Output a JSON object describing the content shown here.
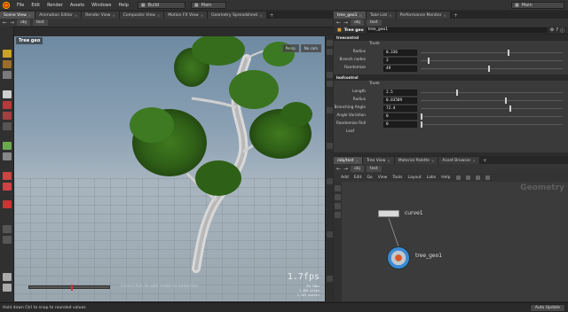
{
  "menubar": {
    "items": [
      "File",
      "Edit",
      "Render",
      "Assets",
      "Windows",
      "Help"
    ],
    "desktop": "Build",
    "desktop2": "Main",
    "right_desktop": "Main"
  },
  "left_tabs": [
    "Scene View",
    "Animation Editor",
    "Render View",
    "Composite View",
    "Motion FX View",
    "Geometry Spreadsheet"
  ],
  "left_path": "obj",
  "left_node": "test",
  "viewport": {
    "title": "Tree geo",
    "persp": "Persp",
    "cam": "No cam",
    "fps": "1.7fps",
    "stats": [
      "58.78ms",
      "1,400  prims",
      "1,162  points"
    ],
    "ghost_text": "Ctrl+Click to add node to selection",
    "timeline_value": 0.52
  },
  "params": {
    "tabs": [
      "tree_geo1",
      "Take List",
      "Performance Monitor"
    ],
    "path": "obj",
    "node": "test",
    "header_title": "Tree geo",
    "header_name": "tree_geo1",
    "section1": "treecontrol",
    "trunk_label": "Trunk",
    "rows1": [
      {
        "label": "Radius",
        "value": "0.336",
        "knob": 0.62
      },
      {
        "label": "Branch nodes",
        "value": "3",
        "knob": 0.05
      },
      {
        "label": "Randomize",
        "value": "49",
        "knob": 0.48
      }
    ],
    "section2": "leafcontrol",
    "trunk_label2": "Trunk",
    "rows2": [
      {
        "label": "Length",
        "value": "2.5",
        "knob": 0.25
      },
      {
        "label": "Radius",
        "value": "0.03509",
        "knob": 0.6
      },
      {
        "label": "Branching Angle",
        "value": "72.4",
        "knob": 0.63
      },
      {
        "label": "Angle Variation",
        "value": "0",
        "knob": 0.0
      },
      {
        "label": "Randomize Roll",
        "value": "0",
        "knob": 0.0
      }
    ],
    "leaf_label": "Leaf"
  },
  "network": {
    "tabs": [
      "/obj/test",
      "Tree View",
      "Material Palette",
      "Asset Browser"
    ],
    "path": "obj",
    "node": "test",
    "menu": [
      "Add",
      "Edit",
      "Go",
      "View",
      "Tools",
      "Layout",
      "Labs",
      "Help"
    ],
    "context_label": "Geometry",
    "node1": "curve1",
    "node2": "tree_geo1"
  },
  "status": {
    "text": "Hold down Ctrl to snap to rounded values",
    "update": "Auto Update"
  }
}
